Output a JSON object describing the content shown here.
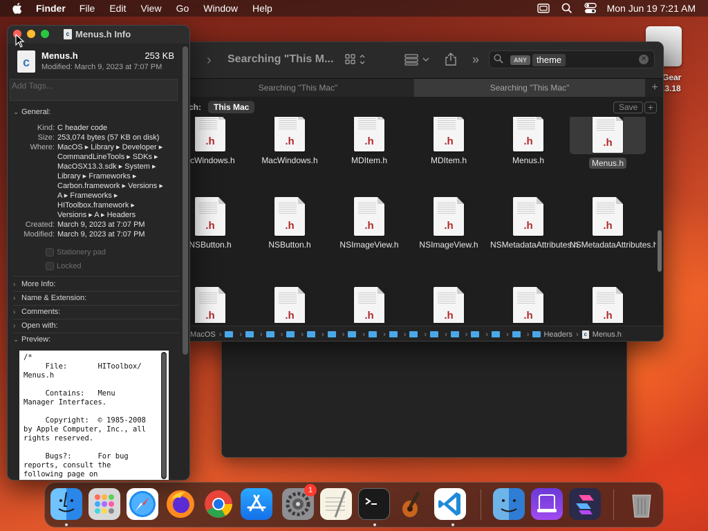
{
  "menubar": {
    "app_name": "Finder",
    "menus": [
      "File",
      "Edit",
      "View",
      "Go",
      "Window",
      "Help"
    ],
    "clock": "Mon Jun 19  7:21 AM"
  },
  "desktop": {
    "drive_label_line1": "Gear",
    "drive_label_line2": ".3.18"
  },
  "finder": {
    "title": "Searching \"This M...",
    "search_token_kind": "ANY",
    "search_token_value": "theme",
    "tabs": [
      "Searching \"This Mac\"",
      "Searching \"This Mac\""
    ],
    "scope_label": "ch:",
    "scope_value": "This Mac",
    "save_label": "Save",
    "files_row1": [
      "acWindows.h",
      "MacWindows.h",
      "MDItem.h",
      "MDItem.h",
      "Menus.h",
      "Menus.h"
    ],
    "files_row2": [
      "NSButton.h",
      "NSButton.h",
      "NSImageView.h",
      "NSImageView.h",
      "NSMetadataAttributes.h",
      "NSMetadataAttributes.h"
    ],
    "ext_label": ".h",
    "path": {
      "first": "MacOS",
      "headers": "Headers",
      "file": "Menus.h"
    }
  },
  "info": {
    "title": "Menus.h Info",
    "file_name": "Menus.h",
    "file_size": "253 KB",
    "modified_line": "Modified: March 9, 2023 at 7:07 PM",
    "tags_placeholder": "Add Tags...",
    "general_label": "General:",
    "kind_key": "Kind:",
    "kind_value": "C header code",
    "size_key": "Size:",
    "size_value": "253,074 bytes (57 KB on disk)",
    "where_key": "Where:",
    "where_lines": [
      "MacOS ▸ Library ▸ Developer ▸",
      "CommandLineTools ▸ SDKs ▸",
      "MacOSX13.3.sdk ▸ System ▸",
      "Library ▸ Frameworks ▸",
      "Carbon.framework ▸ Versions ▸",
      "A ▸ Frameworks ▸",
      "HIToolbox.framework ▸",
      "Versions ▸ A ▸ Headers"
    ],
    "created_key": "Created:",
    "created_value": "March 9, 2023 at 7:07 PM",
    "modified_key": "Modified:",
    "modified_value": "March 9, 2023 at 7:07 PM",
    "stationery_label": "Stationery pad",
    "locked_label": "Locked",
    "more_info_label": "More Info:",
    "name_ext_label": "Name & Extension:",
    "comments_label": "Comments:",
    "open_with_label": "Open with:",
    "preview_label": "Preview:",
    "preview_text": "/*\n     File:       HIToolbox/\nMenus.h\n\n     Contains:   Menu\nManager Interfaces.\n\n     Copyright:  © 1985-2008\nby Apple Computer, Inc., all\nrights reserved.\n\n     Bugs?:      For bug\nreports, consult the\nfollowing page on\n                 the World"
  },
  "dock": {
    "settings_badge": "1"
  },
  "colors": {
    "close": "#ff5f57",
    "minimize": "#febc2e",
    "maximize": "#28c840",
    "header_ext": "#b1282a",
    "folder": "#4aa8e8"
  }
}
